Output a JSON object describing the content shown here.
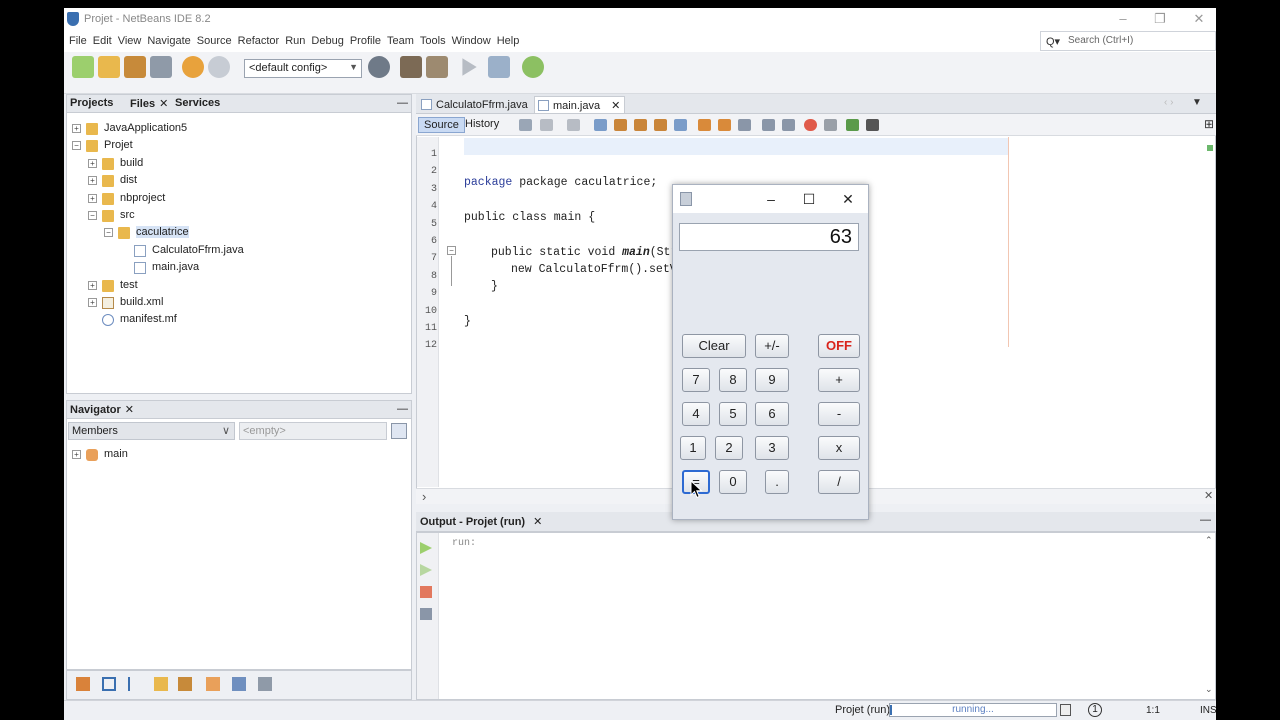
{
  "window": {
    "title": "Projet - NetBeans IDE 8.2",
    "min": "–",
    "max": "❐",
    "close": "✕"
  },
  "menubar": [
    "File",
    "Edit",
    "View",
    "Navigate",
    "Source",
    "Refactor",
    "Run",
    "Debug",
    "Profile",
    "Team",
    "Tools",
    "Window",
    "Help"
  ],
  "search": {
    "placeholder": "Search (Ctrl+I)",
    "icon": "Q▾"
  },
  "toolbar": {
    "config_value": "<default config>"
  },
  "projects_panel": {
    "tabs": {
      "projects": "Projects",
      "files": "Files",
      "services": "Services",
      "minimize": "—",
      "close": "✕"
    },
    "tree": [
      {
        "label": "JavaApplication5",
        "exp": "+",
        "icon": "folder"
      },
      {
        "label": "Projet",
        "exp": "−",
        "icon": "folder"
      },
      {
        "label": "build",
        "exp": "+",
        "icon": "folder"
      },
      {
        "label": "dist",
        "exp": "+",
        "icon": "folder"
      },
      {
        "label": "nbproject",
        "exp": "+",
        "icon": "folder"
      },
      {
        "label": "src",
        "exp": "−",
        "icon": "folder"
      },
      {
        "label": "caculatrice",
        "exp": "−",
        "icon": "folder"
      },
      {
        "label": "CalculatoFfrm.java",
        "exp": "",
        "icon": "java"
      },
      {
        "label": "main.java",
        "exp": "",
        "icon": "java"
      },
      {
        "label": "test",
        "exp": "+",
        "icon": "folder"
      },
      {
        "label": "build.xml",
        "exp": "+",
        "icon": "xml"
      },
      {
        "label": "manifest.mf",
        "exp": "",
        "icon": "mf"
      }
    ]
  },
  "navigator": {
    "tab": "Navigator",
    "close": "✕",
    "minimize": "—",
    "members": "Members",
    "empty": "<empty>",
    "tree_item": "main"
  },
  "editor": {
    "tabs": [
      {
        "label": "CalculatoFfrm.java",
        "close": "✕"
      },
      {
        "label": "main.java",
        "close": "✕"
      }
    ],
    "source_tab": "Source",
    "history_tab": "History",
    "line_numbers": [
      "1",
      "2",
      "3",
      "4",
      "5",
      "6",
      "7",
      "8",
      "9",
      "10",
      "11",
      "12"
    ],
    "lines": {
      "l3": "package caculatrice;",
      "l5": "public class main {",
      "l7a": "public static void ",
      "l7b": "main",
      "l7c": "(Str",
      "l8": "new CalculatoFfrm().setV",
      "l9": "}",
      "l11": "}"
    },
    "fold_marker": "−"
  },
  "output": {
    "tab": "Output - Projet (run)",
    "close": "✕",
    "text": "run:"
  },
  "statusbar": {
    "project": "Projet (run)",
    "progress_text": "running...",
    "position": "1:1",
    "mode": "INS"
  },
  "calculator": {
    "display": "63",
    "min": "–",
    "max": "☐",
    "close": "✕",
    "buttons": {
      "clear": "Clear",
      "sign": "+/-",
      "off": "OFF",
      "b7": "7",
      "b8": "8",
      "b9": "9",
      "plus": "+",
      "b4": "4",
      "b5": "5",
      "b6": "6",
      "minus": "-",
      "b1": "1",
      "b2": "2",
      "b3": "3",
      "times": "x",
      "equals": "=",
      "b0": "0",
      "dot": ".",
      "divide": "/"
    }
  }
}
